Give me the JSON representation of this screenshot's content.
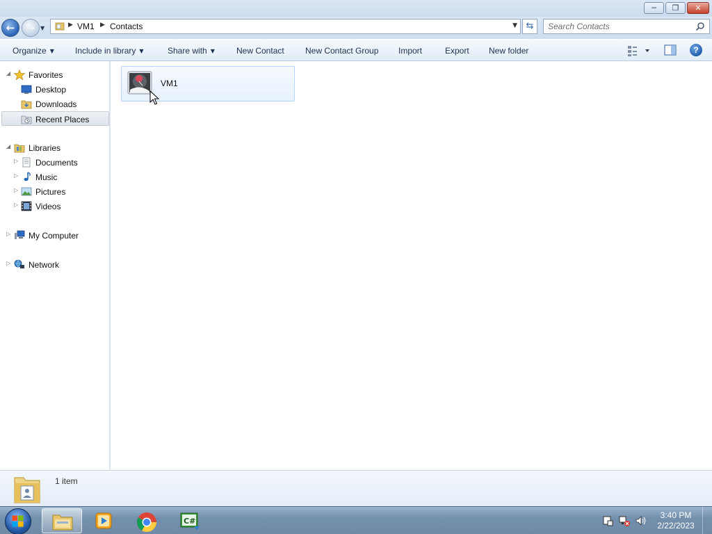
{
  "window": {
    "minimize_glyph": "─",
    "maximize_glyph": "❐",
    "close_glyph": "✕"
  },
  "address_bar": {
    "breadcrumbs": [
      "VM1",
      "Contacts"
    ]
  },
  "search": {
    "placeholder": "Search Contacts"
  },
  "command_bar": {
    "organize": "Organize",
    "include_in_library": "Include in library",
    "share_with": "Share with",
    "new_contact": "New Contact",
    "new_contact_group": "New Contact Group",
    "import": "Import",
    "export": "Export",
    "new_folder": "New folder"
  },
  "nav_pane": {
    "favorites": "Favorites",
    "desktop": "Desktop",
    "downloads": "Downloads",
    "recent_places": "Recent Places",
    "libraries": "Libraries",
    "documents": "Documents",
    "music": "Music",
    "pictures": "Pictures",
    "videos": "Videos",
    "my_computer": "My Computer",
    "network": "Network"
  },
  "content": {
    "items": [
      {
        "label": "VM1",
        "icon": "contact-card-icon"
      }
    ]
  },
  "details_pane": {
    "item_count": "1 item"
  },
  "taskbar": {
    "apps": [
      "windows-explorer",
      "media-player",
      "chrome",
      "csharp-ide"
    ],
    "clock_time": "3:40 PM",
    "clock_date": "2/22/2023"
  },
  "colors": {
    "accent_blue": "#2b64b6",
    "selection_border": "#b8d6fb",
    "taskbar": "#7390ad"
  }
}
